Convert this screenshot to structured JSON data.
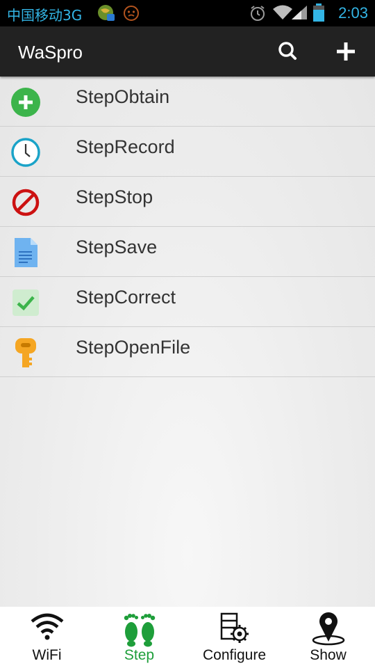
{
  "status_bar": {
    "carrier": "中国移动3G",
    "time": "2:03"
  },
  "action_bar": {
    "title": "WaSpro",
    "search_icon": "search-icon",
    "add_icon": "plus-icon"
  },
  "steps": [
    {
      "label": "StepObtain",
      "icon": "plus-circle-icon",
      "color": "#3cb44b"
    },
    {
      "label": "StepRecord",
      "icon": "clock-icon",
      "color": "#1aa3c8"
    },
    {
      "label": "StepStop",
      "icon": "no-entry-icon",
      "color": "#cc1111"
    },
    {
      "label": "StepSave",
      "icon": "document-icon",
      "color": "#6fb3f0"
    },
    {
      "label": "StepCorrect",
      "icon": "checkmark-icon",
      "color": "#3cb44b"
    },
    {
      "label": "StepOpenFile",
      "icon": "key-icon",
      "color": "#f5a623"
    }
  ],
  "tabs": [
    {
      "label": "WiFi",
      "icon": "wifi-icon",
      "active": false
    },
    {
      "label": "Step",
      "icon": "footprints-icon",
      "active": true
    },
    {
      "label": "Configure",
      "icon": "configure-icon",
      "active": false
    },
    {
      "label": "Show",
      "icon": "map-pin-icon",
      "active": false
    }
  ],
  "colors": {
    "status_text": "#33b5e5",
    "action_bar": "#222222",
    "active_tab": "#1e9e3a"
  }
}
